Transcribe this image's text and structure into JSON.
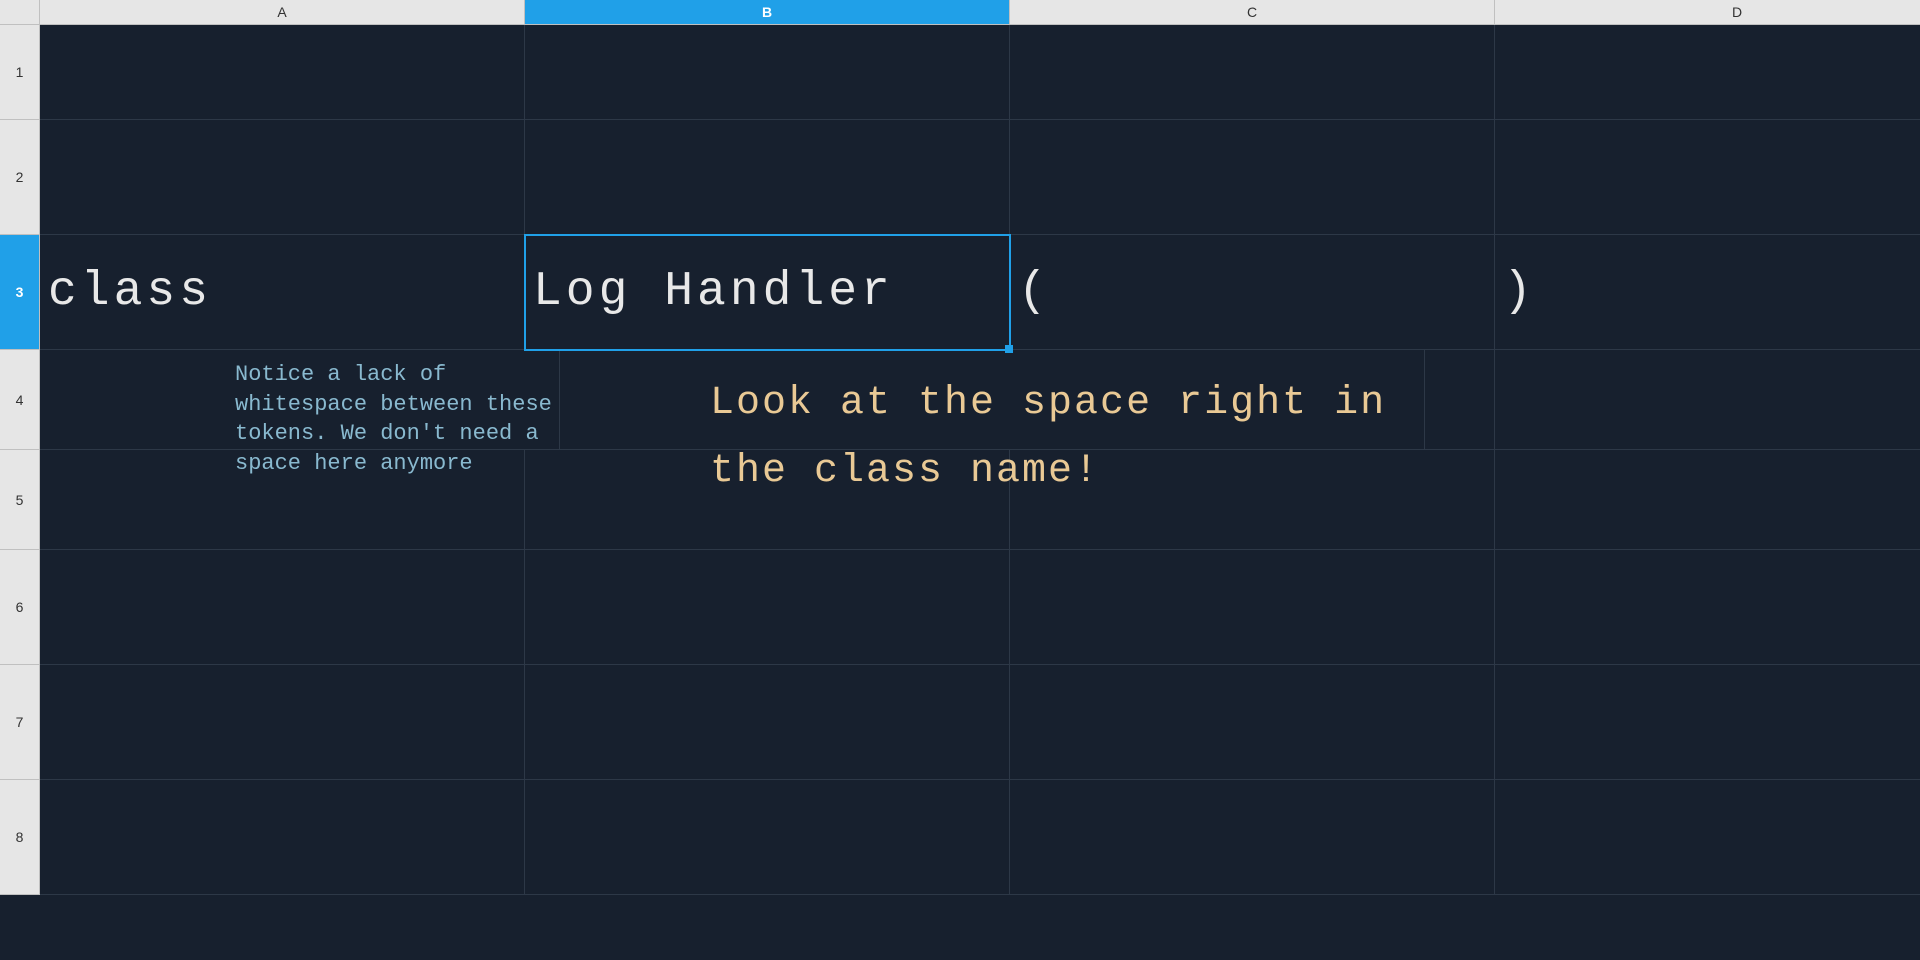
{
  "columns": [
    "A",
    "B",
    "C",
    "D"
  ],
  "rows": [
    "1",
    "2",
    "3",
    "4",
    "5",
    "6",
    "7",
    "8"
  ],
  "active_column_index": 1,
  "active_row_index": 2,
  "selected_cell": "B3",
  "cells": {
    "A3": "class",
    "B3": "Log Handler",
    "C3": "(",
    "D3": ")"
  },
  "annotations": {
    "blue": "Notice a lack of whitespace between these tokens. We don't need a space here anymore",
    "yellow": "Look at the space right in the class name!"
  }
}
